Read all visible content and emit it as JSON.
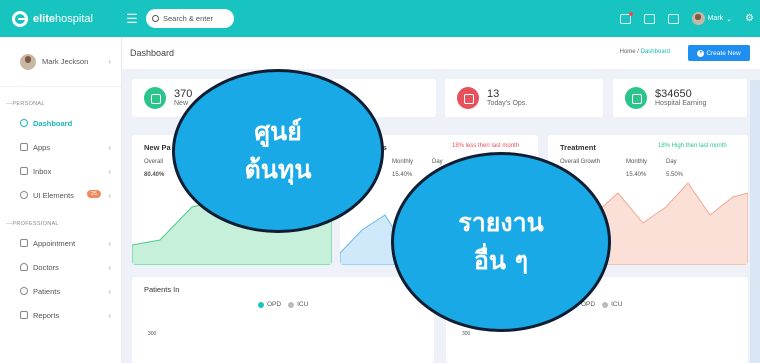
{
  "brand": {
    "name_bold": "elite",
    "name_light": "hospital"
  },
  "search": {
    "placeholder": "Search & enter"
  },
  "topbar": {
    "user_name": "Mark"
  },
  "sidebar": {
    "profile_name": "Mark Jeckson",
    "section_personal": "PERSONAL",
    "section_professional": "PROFESSIONAL",
    "items": [
      {
        "label": "Dashboard"
      },
      {
        "label": "Apps"
      },
      {
        "label": "Inbox"
      },
      {
        "label": "UI Elements",
        "badge": "25"
      },
      {
        "label": "Appointment"
      },
      {
        "label": "Doctors"
      },
      {
        "label": "Patients"
      },
      {
        "label": "Reports"
      }
    ]
  },
  "header": {
    "title": "Dashboard",
    "crumb_home": "Home",
    "crumb_current": "Dashboard",
    "create_label": "Create New"
  },
  "stats": [
    {
      "value": "370",
      "label": "New"
    },
    {
      "value": "13",
      "label": "Today's Ops."
    },
    {
      "value": "$34650",
      "label": "Hospital Earning"
    }
  ],
  "charts": {
    "new_title": "New Pa",
    "new_overall": "Overall",
    "new_pct": "80.40%",
    "mid_title": "ts",
    "mid_note": "18% less then last month",
    "mid_monthly": "Monthly",
    "mid_day": "Day",
    "mid_pct": "15.40%",
    "treat_title": "Treatment",
    "treat_note": "18% High then last month",
    "treat_overall": "Overall Growth",
    "treat_monthly": "Monthly",
    "treat_day": "Day",
    "treat_monthly_pct": "15.40%",
    "treat_day_pct": "5.50%",
    "patients_title": "Patients In",
    "legend_opd": "OPD",
    "legend_icu": "ICU",
    "axis_300_left": "300",
    "axis_300_right": "300"
  },
  "overlays": {
    "bubble1": "ศูนย์\nต้นทุน",
    "bubble2": "รายงาน\nอื่น ๆ"
  },
  "colors": {
    "teal": "#18c4c0",
    "blue": "#1f8ef1",
    "green": "#2bc48a",
    "red": "#e5525b",
    "bubble": "#18a9e6"
  }
}
